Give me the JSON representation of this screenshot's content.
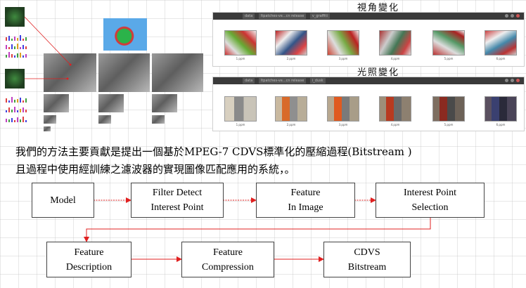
{
  "window_variation_view": {
    "title": "視角變化",
    "breadcrumb": [
      "data",
      "Itpatches-ve...cn release",
      "v_graffiti"
    ],
    "files": [
      "1.ppm",
      "2.ppm",
      "3.ppm",
      "4.ppm",
      "5.ppm",
      "6.ppm"
    ]
  },
  "window_variation_light": {
    "title": "光照變化",
    "breadcrumb": [
      "data",
      "Itpatches-ve...cn release",
      "i_dusk"
    ],
    "files": [
      "1.ppm",
      "2.ppm",
      "3.ppm",
      "4.ppm",
      "5.ppm",
      "6.ppm"
    ]
  },
  "paragraph": {
    "line1": "我們的方法主要貢獻是提出一個基於MPEG-7 CDVS標準化的壓縮過程(Bitstream )",
    "line2": "且過程中使用經訓練之濾波器的實現圖像匹配應用的系統，。"
  },
  "pipeline": {
    "model": [
      "Model"
    ],
    "filter_detect": [
      "Filter Detect",
      "Interest Point"
    ],
    "feature_in_image": [
      "Feature",
      "In Image"
    ],
    "interest_point_selection": [
      "Interest Point",
      "Selection"
    ],
    "feature_description": [
      "Feature",
      "Description"
    ],
    "feature_compression": [
      "Feature",
      "Compression"
    ],
    "cdvs_bitstream": [
      "CDVS",
      "Bitstream"
    ]
  },
  "colors": {
    "arrow": "#e02020",
    "box_border": "#444444",
    "titlebar": "#3a3a3a"
  }
}
